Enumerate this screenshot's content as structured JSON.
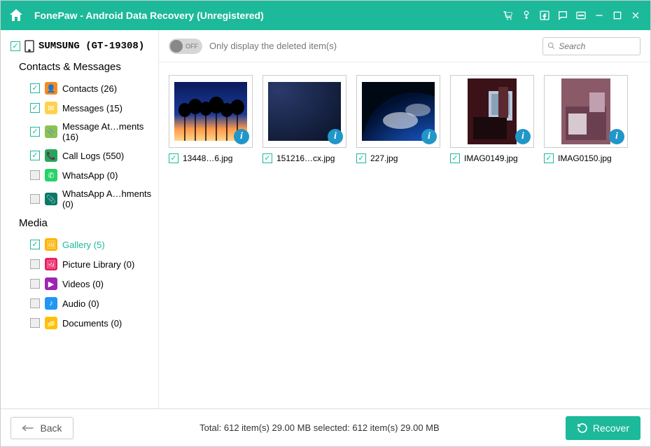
{
  "titlebar": {
    "title": "FonePaw - Android Data Recovery (Unregistered)"
  },
  "device": {
    "name": "SUMSUNG (GT-19308)"
  },
  "sections": {
    "contacts": {
      "title": "Contacts & Messages"
    },
    "media": {
      "title": "Media"
    }
  },
  "sidebar": {
    "contacts": [
      {
        "label": "Contacts (26)",
        "checked": true,
        "iconBg": "#f68b1f",
        "glyph": "👤"
      },
      {
        "label": "Messages (15)",
        "checked": true,
        "iconBg": "#ffd24d",
        "glyph": "✉"
      },
      {
        "label": "Message At…ments (16)",
        "checked": true,
        "iconBg": "#8bc34a",
        "glyph": "📎"
      },
      {
        "label": "Call Logs (550)",
        "checked": true,
        "iconBg": "#26a65b",
        "glyph": "📞"
      },
      {
        "label": "WhatsApp (0)",
        "checked": false,
        "iconBg": "#25d366",
        "glyph": "✆"
      },
      {
        "label": "WhatsApp A…hments (0)",
        "checked": false,
        "iconBg": "#0b7a63",
        "glyph": "📎"
      }
    ],
    "media": [
      {
        "label": "Gallery (5)",
        "checked": true,
        "active": true,
        "iconBg": "#ffb300",
        "glyph": "🖼"
      },
      {
        "label": "Picture Library (0)",
        "checked": false,
        "iconBg": "#e91e63",
        "glyph": "🖼"
      },
      {
        "label": "Videos (0)",
        "checked": false,
        "iconBg": "#9c27b0",
        "glyph": "▶"
      },
      {
        "label": "Audio (0)",
        "checked": false,
        "iconBg": "#2196f3",
        "glyph": "♪"
      },
      {
        "label": "Documents (0)",
        "checked": false,
        "iconBg": "#ffc107",
        "glyph": "📁"
      }
    ]
  },
  "toolbar": {
    "toggle_text": "OFF",
    "hint": "Only display the deleted item(s)",
    "search_placeholder": "Search"
  },
  "thumbs": [
    {
      "caption": "13448…6.jpg",
      "checked": true,
      "style": "sunset"
    },
    {
      "caption": "151216…cx.jpg",
      "checked": true,
      "style": "dark"
    },
    {
      "caption": "227.jpg",
      "checked": true,
      "style": "earth"
    },
    {
      "caption": "IMAG0149.jpg",
      "checked": true,
      "style": "room1"
    },
    {
      "caption": "IMAG0150.jpg",
      "checked": true,
      "style": "room2"
    }
  ],
  "footer": {
    "back": "Back",
    "status": "Total: 612 item(s) 29.00 MB   selected: 612 item(s) 29.00 MB",
    "recover": "Recover"
  }
}
